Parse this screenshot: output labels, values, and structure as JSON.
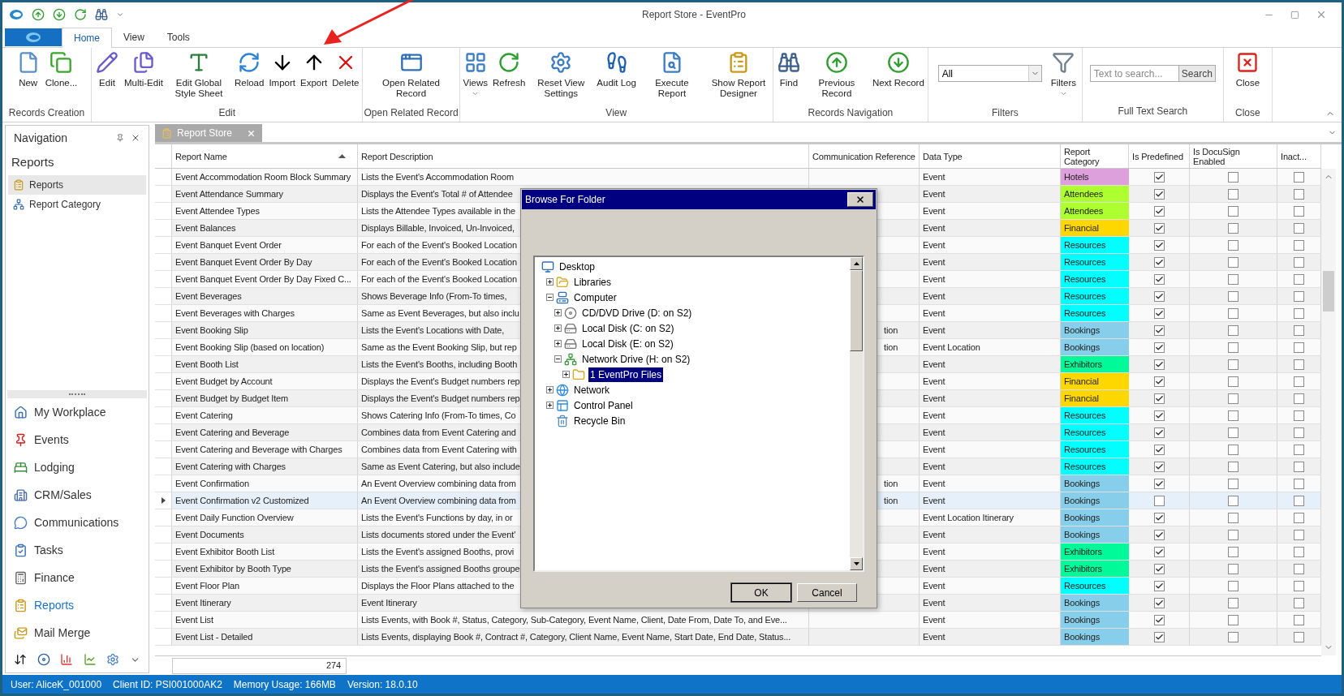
{
  "window": {
    "title": "Report Store - EventPro"
  },
  "ribbon_tabs": [
    {
      "label": "Home",
      "selected": true
    },
    {
      "label": "View",
      "selected": false
    },
    {
      "label": "Tools",
      "selected": false
    }
  ],
  "ribbon_groups": [
    {
      "label": "Records Creation",
      "items": [
        {
          "kind": "button",
          "label": "New"
        },
        {
          "kind": "button",
          "label": "Clone..."
        }
      ]
    },
    {
      "label": "Edit",
      "items": [
        {
          "kind": "button",
          "label": "Edit"
        },
        {
          "kind": "button",
          "label": "Multi-Edit"
        },
        {
          "kind": "button",
          "label": "Edit Global Style Sheet"
        },
        {
          "kind": "button",
          "label": "Reload"
        },
        {
          "kind": "button",
          "label": "Import"
        },
        {
          "kind": "button",
          "label": "Export"
        },
        {
          "kind": "button",
          "label": "Delete"
        }
      ]
    },
    {
      "label": "Open Related Record",
      "items": [
        {
          "kind": "button",
          "label": "Open Related Record"
        }
      ]
    },
    {
      "label": "View",
      "items": [
        {
          "kind": "dropdown",
          "label": "Views"
        },
        {
          "kind": "button",
          "label": "Refresh"
        },
        {
          "kind": "button",
          "label": "Reset View Settings"
        },
        {
          "kind": "button",
          "label": "Audit Log"
        },
        {
          "kind": "button",
          "label": "Execute Report"
        },
        {
          "kind": "button",
          "label": "Show Report Designer"
        }
      ]
    },
    {
      "label": "Records Navigation",
      "items": [
        {
          "kind": "button",
          "label": "Find"
        },
        {
          "kind": "button",
          "label": "Previous Record"
        },
        {
          "kind": "button",
          "label": "Next Record"
        }
      ]
    },
    {
      "label": "Filters",
      "items": [
        {
          "kind": "select",
          "value": "All"
        },
        {
          "kind": "dropdown",
          "label": "Filters"
        }
      ]
    },
    {
      "label": "Full Text Search",
      "items": [
        {
          "kind": "search",
          "placeholder": "Text to search...",
          "button": "Search"
        }
      ]
    },
    {
      "label": "Close",
      "items": [
        {
          "kind": "button",
          "label": "Close"
        }
      ]
    }
  ],
  "navigation": {
    "title": "Navigation",
    "section": "Reports",
    "items": [
      {
        "label": "Reports",
        "selected": true
      },
      {
        "label": "Report Category",
        "selected": false
      }
    ],
    "modules": [
      {
        "label": "My Workplace",
        "selected": false
      },
      {
        "label": "Events",
        "selected": false
      },
      {
        "label": "Lodging",
        "selected": false
      },
      {
        "label": "CRM/Sales",
        "selected": false
      },
      {
        "label": "Communications",
        "selected": false
      },
      {
        "label": "Tasks",
        "selected": false
      },
      {
        "label": "Finance",
        "selected": false
      },
      {
        "label": "Reports",
        "selected": true
      },
      {
        "label": "Mail Merge",
        "selected": false
      }
    ]
  },
  "document_tab": {
    "label": "Report Store"
  },
  "table": {
    "columns": [
      {
        "label": "Report Name",
        "sorted": true
      },
      {
        "label": "Report Description",
        "sorted": false
      },
      {
        "label": "Communication Reference",
        "sorted": false
      },
      {
        "label": "Data Type",
        "sorted": false
      },
      {
        "label": "Report Category",
        "sorted": false
      },
      {
        "label": "Is Predefined",
        "sorted": false
      },
      {
        "label": "Is DocuSign Enabled",
        "sorted": false
      },
      {
        "label": "Inact...",
        "sorted": false
      }
    ],
    "rows": [
      {
        "name": "Event Accommodation Room Block Summary",
        "description": "Lists the Event's Accommodation Room",
        "data_type": "Event",
        "category": "Hotels",
        "color": "#dda0dd",
        "predefined": true,
        "docusign": false,
        "inactive": false,
        "selected": false
      },
      {
        "name": "Event Attendance Summary",
        "description": "Displays the Event's Total # of Attendee",
        "data_type": "Event",
        "category": "Attendees",
        "color": "#adff2f",
        "predefined": true,
        "docusign": false,
        "inactive": false,
        "selected": false
      },
      {
        "name": "Event Attendee Types",
        "description": "Lists the Attendee Types available in the",
        "data_type": "Event",
        "category": "Attendees",
        "color": "#adff2f",
        "predefined": true,
        "docusign": false,
        "inactive": false,
        "selected": false
      },
      {
        "name": "Event Balances",
        "description": "Displays Billable, Invoiced, Un-Invoiced,",
        "data_type": "Event",
        "category": "Financial",
        "color": "#ffd700",
        "predefined": true,
        "docusign": false,
        "inactive": false,
        "selected": false
      },
      {
        "name": "Event Banquet Event Order",
        "description": "For each of the Event's Booked Location",
        "data_type": "Event",
        "category": "Resources",
        "color": "#00ffff",
        "predefined": true,
        "docusign": false,
        "inactive": false,
        "selected": false
      },
      {
        "name": "Event Banquet Event Order By Day",
        "description": "For each of the Event's Booked Location",
        "data_type": "Event",
        "category": "Resources",
        "color": "#00ffff",
        "predefined": true,
        "docusign": false,
        "inactive": false,
        "selected": false
      },
      {
        "name": "Event Banquet Event Order By Day Fixed C...",
        "description": "For each of the Event's Booked Location",
        "data_type": "Event",
        "category": "Resources",
        "color": "#00ffff",
        "predefined": true,
        "docusign": false,
        "inactive": false,
        "selected": false
      },
      {
        "name": "Event Beverages",
        "description": "Shows Beverage Info (From-To times,",
        "data_type": "Event",
        "category": "Resources",
        "color": "#00ffff",
        "predefined": true,
        "docusign": false,
        "inactive": false,
        "selected": false
      },
      {
        "name": "Event Beverages with Charges",
        "description": "Same as Event Beverages, but also inclu",
        "data_type": "Event",
        "category": "Resources",
        "color": "#00ffff",
        "predefined": true,
        "docusign": false,
        "inactive": false,
        "selected": false
      },
      {
        "name": "Event Booking Slip",
        "description": "Lists the Event's Locations with Date,",
        "comm_ref": "tion",
        "data_type": "Event",
        "category": "Bookings",
        "color": "#87ceeb",
        "predefined": true,
        "docusign": false,
        "inactive": false,
        "selected": false
      },
      {
        "name": "Event Booking Slip (based on location)",
        "description": "Same as the Event Booking Slip, but rep",
        "comm_ref": "tion",
        "data_type": "Event Location",
        "category": "Bookings",
        "color": "#87ceeb",
        "predefined": true,
        "docusign": false,
        "inactive": false,
        "selected": false
      },
      {
        "name": "Event Booth List",
        "description": "Lists the Event's Booths, including Booth",
        "data_type": "Event",
        "category": "Exhibitors",
        "color": "#00fa9a",
        "predefined": true,
        "docusign": false,
        "inactive": false,
        "selected": false
      },
      {
        "name": "Event Budget by Account",
        "description": "Displays the Event's Budget numbers rep",
        "data_type": "Event",
        "category": "Financial",
        "color": "#ffd700",
        "predefined": true,
        "docusign": false,
        "inactive": false,
        "selected": false
      },
      {
        "name": "Event Budget by Budget Item",
        "description": "Displays the Event's Budget numbers rep",
        "data_type": "Event",
        "category": "Financial",
        "color": "#ffd700",
        "predefined": true,
        "docusign": false,
        "inactive": false,
        "selected": false
      },
      {
        "name": "Event Catering",
        "description": "Shows Catering Info (From-To times, Co",
        "data_type": "Event",
        "category": "Resources",
        "color": "#00ffff",
        "predefined": true,
        "docusign": false,
        "inactive": false,
        "selected": false
      },
      {
        "name": "Event Catering and Beverage",
        "description": "Combines data from Event Catering and",
        "data_type": "Event",
        "category": "Resources",
        "color": "#00ffff",
        "predefined": true,
        "docusign": false,
        "inactive": false,
        "selected": false
      },
      {
        "name": "Event Catering and Beverage with Charges",
        "description": "Combines data from Event Catering with",
        "data_type": "Event",
        "category": "Resources",
        "color": "#00ffff",
        "predefined": true,
        "docusign": false,
        "inactive": false,
        "selected": false
      },
      {
        "name": "Event Catering with Charges",
        "description": "Same as Event Catering, but also include",
        "data_type": "Event",
        "category": "Resources",
        "color": "#00ffff",
        "predefined": true,
        "docusign": false,
        "inactive": false,
        "selected": false
      },
      {
        "name": "Event Confirmation",
        "description": "An Event Overview combining data from",
        "comm_ref": "tion",
        "data_type": "Event",
        "category": "Bookings",
        "color": "#87ceeb",
        "predefined": true,
        "docusign": false,
        "inactive": false,
        "selected": false
      },
      {
        "name": "Event Confirmation v2 Customized",
        "description": "An Event Overview combining data from",
        "comm_ref": "tion",
        "data_type": "Event",
        "category": "Bookings",
        "color": "#87ceeb",
        "predefined": false,
        "docusign": false,
        "inactive": false,
        "selected": true
      },
      {
        "name": "Event Daily Function Overview",
        "description": "Lists the Event's Functions by day, in or",
        "data_type": "Event Location Itinerary",
        "category": "Bookings",
        "color": "#87ceeb",
        "predefined": true,
        "docusign": false,
        "inactive": false,
        "selected": false
      },
      {
        "name": "Event Documents",
        "description": "Lists documents stored under the Event'",
        "data_type": "Event",
        "category": "Bookings",
        "color": "#87ceeb",
        "predefined": true,
        "docusign": false,
        "inactive": false,
        "selected": false
      },
      {
        "name": "Event Exhibitor Booth List",
        "description": "Lists the Event's assigned Booths, provi",
        "data_type": "Event",
        "category": "Exhibitors",
        "color": "#00fa9a",
        "predefined": true,
        "docusign": false,
        "inactive": false,
        "selected": false
      },
      {
        "name": "Event Exhibitor by Booth Type",
        "description": "Lists the Event's assigned Booths groupe",
        "data_type": "Event",
        "category": "Exhibitors",
        "color": "#00fa9a",
        "predefined": true,
        "docusign": false,
        "inactive": false,
        "selected": false
      },
      {
        "name": "Event Floor Plan",
        "description": "Displays the Floor Plans attached to the",
        "data_type": "Event",
        "category": "Resources",
        "color": "#00ffff",
        "predefined": true,
        "docusign": false,
        "inactive": false,
        "selected": false
      },
      {
        "name": "Event Itinerary",
        "description": "Event Itinerary",
        "data_type": "Event",
        "category": "Bookings",
        "color": "#87ceeb",
        "predefined": true,
        "docusign": false,
        "inactive": false,
        "selected": false
      },
      {
        "name": "Event List",
        "description": "Lists Events, with Book #, Status, Category, Sub-Category, Event Name, Client, Date From, Date To, and Eve...",
        "data_type": "Event",
        "category": "Bookings",
        "color": "#87ceeb",
        "predefined": true,
        "docusign": false,
        "inactive": false,
        "selected": false
      },
      {
        "name": "Event List - Detailed",
        "description": "Lists Events, displaying Book #, Contract #, Category, Client Name, Event Name, Start Date, End Date, Status...",
        "data_type": "Event",
        "category": "Bookings",
        "color": "#87ceeb",
        "predefined": true,
        "docusign": false,
        "inactive": false,
        "selected": false
      }
    ],
    "footer_count": "274"
  },
  "dialog": {
    "title": "Browse For Folder",
    "tree": [
      {
        "label": "Desktop",
        "selected": false,
        "children": [
          {
            "label": "Libraries",
            "expanded": false,
            "selected": false
          },
          {
            "label": "Computer",
            "expanded": true,
            "selected": false,
            "children": [
              {
                "label": "CD/DVD Drive (D: on S2)",
                "expanded": false,
                "selected": false
              },
              {
                "label": "Local Disk (C: on S2)",
                "expanded": false,
                "selected": false
              },
              {
                "label": "Local Disk (E: on S2)",
                "expanded": false,
                "selected": false
              },
              {
                "label": "Network Drive (H: on S2)",
                "expanded": true,
                "selected": false,
                "children": [
                  {
                    "label": "1 EventPro Files",
                    "expanded": false,
                    "selected": true
                  }
                ]
              }
            ]
          },
          {
            "label": "Network",
            "expanded": false,
            "selected": false
          },
          {
            "label": "Control Panel",
            "expanded": false,
            "selected": false
          },
          {
            "label": "Recycle Bin",
            "selected": false
          }
        ]
      }
    ],
    "buttons": [
      "OK",
      "Cancel"
    ]
  },
  "status_bar": [
    "User: AliceK_001000",
    "Client ID: PSI001000AK2",
    "Memory Usage: 166MB",
    "Version: 18.0.10"
  ]
}
